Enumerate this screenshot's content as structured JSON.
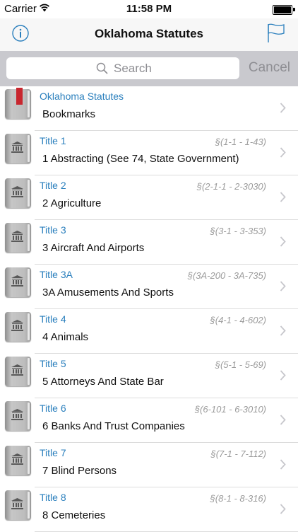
{
  "status_bar": {
    "carrier": "Carrier",
    "time": "11:58 PM"
  },
  "nav": {
    "title": "Oklahoma Statutes",
    "left_icon": "info-icon",
    "right_icon": "flag-icon"
  },
  "search": {
    "placeholder": "Search",
    "cancel_label": "Cancel"
  },
  "colors": {
    "accent": "#2a7fbd",
    "search_bar_bg": "#c9c9ce",
    "bookmark_ribbon": "#c8262e"
  },
  "rows": [
    {
      "title": "Oklahoma Statutes",
      "range": "",
      "subtitle": "Bookmarks",
      "icon": "bookmark-book-icon"
    },
    {
      "title": "Title 1",
      "range": "§(1-1 - 1-43)",
      "subtitle": "1 Abstracting (See 74, State Government)",
      "icon": "courthouse-book-icon"
    },
    {
      "title": "Title 2",
      "range": "§(2-1-1 - 2-3030)",
      "subtitle": "2 Agriculture",
      "icon": "courthouse-book-icon"
    },
    {
      "title": "Title 3",
      "range": "§(3-1 - 3-353)",
      "subtitle": "3 Aircraft And Airports",
      "icon": "courthouse-book-icon"
    },
    {
      "title": "Title 3A",
      "range": "§(3A-200 - 3A-735)",
      "subtitle": "3A Amusements And Sports",
      "icon": "courthouse-book-icon"
    },
    {
      "title": "Title 4",
      "range": "§(4-1 - 4-602)",
      "subtitle": "4 Animals",
      "icon": "courthouse-book-icon"
    },
    {
      "title": "Title 5",
      "range": "§(5-1 - 5-69)",
      "subtitle": "5 Attorneys And State Bar",
      "icon": "courthouse-book-icon"
    },
    {
      "title": "Title 6",
      "range": "§(6-101 - 6-3010)",
      "subtitle": "6 Banks And Trust Companies",
      "icon": "courthouse-book-icon"
    },
    {
      "title": "Title 7",
      "range": "§(7-1 - 7-112)",
      "subtitle": "7 Blind Persons",
      "icon": "courthouse-book-icon"
    },
    {
      "title": "Title 8",
      "range": "§(8-1 - 8-316)",
      "subtitle": "8 Cemeteries",
      "icon": "courthouse-book-icon"
    }
  ]
}
